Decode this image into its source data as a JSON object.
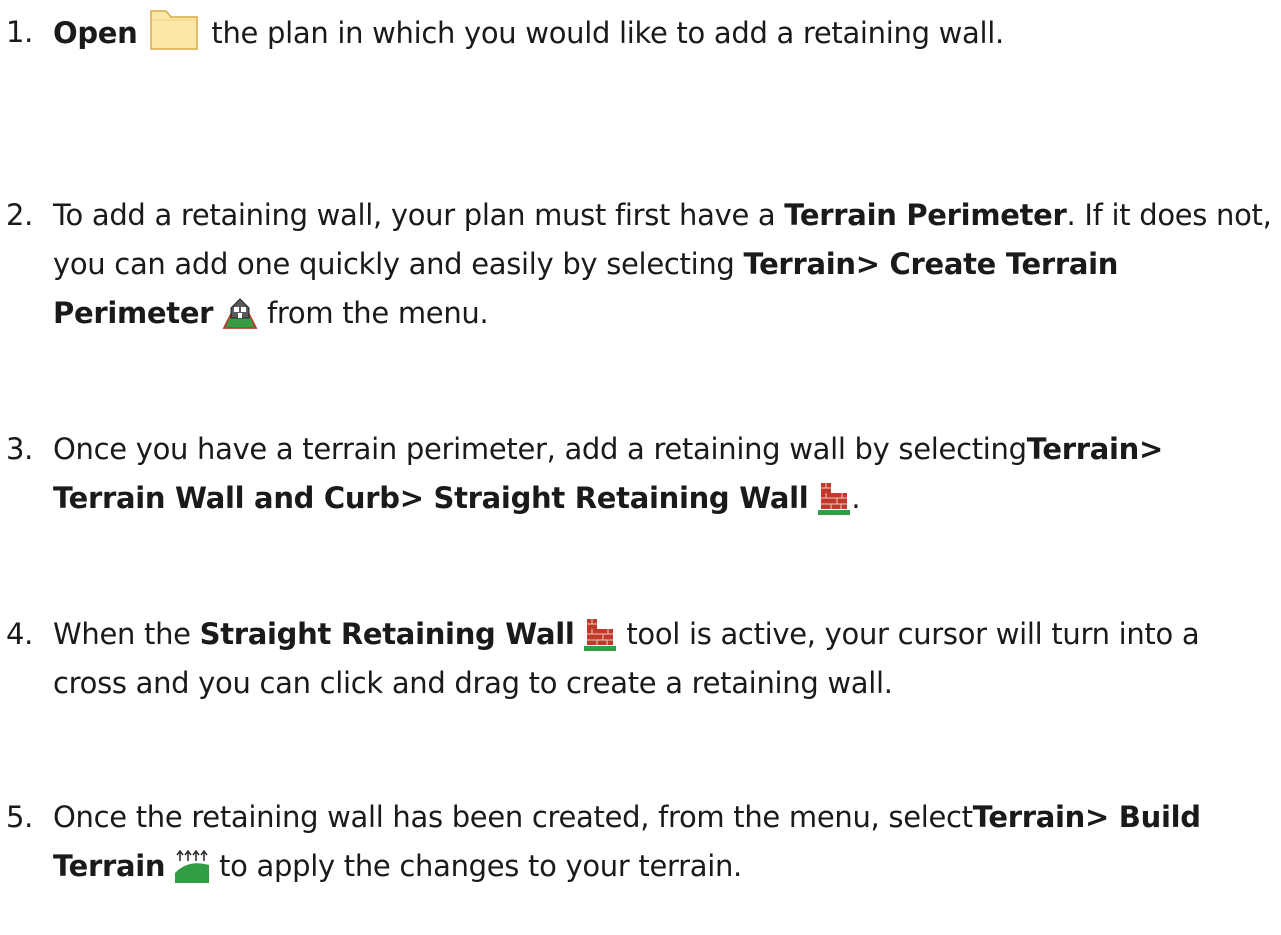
{
  "steps": [
    {
      "num": "1.",
      "open": "Open",
      "t1": " the plan in which you would like to add a retaining wall."
    },
    {
      "num": "2.",
      "t1": "To add a retaining wall, your plan must first have a ",
      "terrain_perimeter": "Terrain Perimeter",
      "t2": ". If it does not, you can add one quickly and easily by selecting ",
      "menu_path": "Terrain> Create Terrain Perimeter",
      "t3": " from the menu."
    },
    {
      "num": "3.",
      "t1": "Once you have a terrain perimeter, add a retaining wall by selecting",
      "menu_path": "Terrain> Terrain Wall and Curb> Straight Retaining Wall",
      "t2": "."
    },
    {
      "num": "4.",
      "t1": "When the ",
      "tool_name": "Straight Retaining Wall",
      "t2": " tool is active, your cursor will turn into a cross and you can click and drag to create a retaining wall."
    },
    {
      "num": "5.",
      "t1": "Once the retaining wall has been created, from the menu, select",
      "menu_path": "Terrain> Build Terrain",
      "t2": " to apply the changes to your terrain."
    }
  ],
  "icons": {
    "open": "folder-icon",
    "create_terrain_perimeter": "terrain-perimeter-icon",
    "straight_retaining_wall": "retaining-wall-icon",
    "build_terrain": "build-terrain-icon"
  },
  "colors": {
    "text": "#1a1a1a",
    "folder_fill": "#fbe7a6",
    "terrain_green": "#2f9e44",
    "wall_red": "#c0392b"
  }
}
